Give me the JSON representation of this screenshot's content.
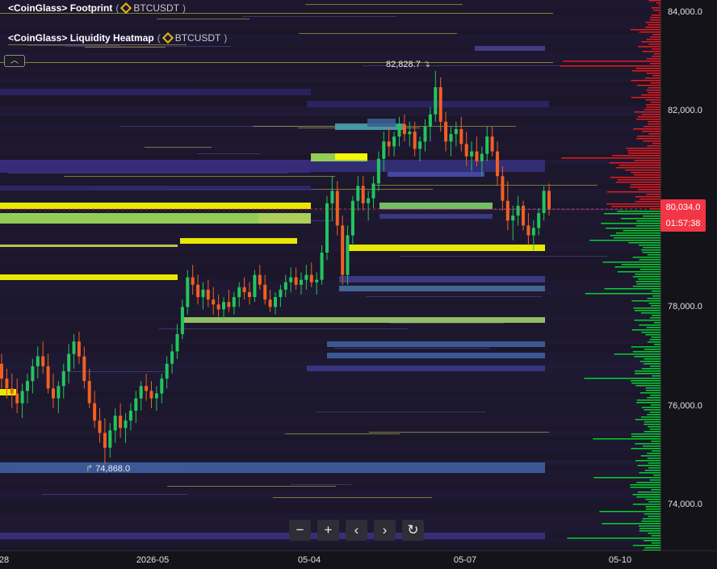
{
  "legend": {
    "footprint": {
      "name": "<CoinGlass> Footprint",
      "symbol": "BTCUSDT"
    },
    "heatmap": {
      "name": "<CoinGlass> Liquidity Heatmap",
      "symbol": "BTCUSDT"
    }
  },
  "collapse_icon": "chevron-up-icon",
  "annotations": {
    "high": "82,828.7",
    "low": "74,868.0"
  },
  "price_axis": {
    "ticks": [
      "84,000.0",
      "82,000.0",
      "78,000.0",
      "76,000.0",
      "74,000.0"
    ]
  },
  "current_price": {
    "price": "80,034.0",
    "countdown": "01:57:38",
    "color": "#f23645"
  },
  "time_axis": {
    "ticks": [
      "28",
      "2026-05",
      "05-04",
      "05-07",
      "05-10"
    ]
  },
  "toolbar": {
    "zoom_out": "−",
    "zoom_in": "+",
    "scroll_left": "‹",
    "scroll_right": "›",
    "reset": "↻"
  },
  "colors": {
    "bull": "#22c55e",
    "bear": "#f25f22",
    "bid_profile": "#00e62e",
    "ask_profile": "#ff1a1a",
    "heat_hot": "#ffff00",
    "heat_warm": "#9ee05a",
    "heat_mid": "#3f5fa0",
    "heat_cold": "#3b2d7a"
  },
  "chart_data": {
    "type": "candlestick",
    "series": [
      {
        "values": [
          [
            76.9,
            77.1,
            76.4,
            76.6
          ],
          [
            76.6,
            76.8,
            76.2,
            76.4
          ],
          [
            76.4,
            76.7,
            76.0,
            76.3
          ],
          [
            76.3,
            76.6,
            75.9,
            76.1
          ],
          [
            76.1,
            76.5,
            75.8,
            76.35
          ],
          [
            76.35,
            76.7,
            76.1,
            76.55
          ],
          [
            76.55,
            77.0,
            76.3,
            76.85
          ],
          [
            76.85,
            77.25,
            76.6,
            77.05
          ],
          [
            77.05,
            77.35,
            76.7,
            76.85
          ],
          [
            76.85,
            77.1,
            76.3,
            76.4
          ],
          [
            76.4,
            76.7,
            76.0,
            76.2
          ],
          [
            76.2,
            76.55,
            75.9,
            76.45
          ],
          [
            76.45,
            76.9,
            76.2,
            76.75
          ],
          [
            76.75,
            77.3,
            76.5,
            77.1
          ],
          [
            77.1,
            77.5,
            76.8,
            77.35
          ],
          [
            77.35,
            77.55,
            76.9,
            77.05
          ],
          [
            77.05,
            77.25,
            76.4,
            76.55
          ],
          [
            76.55,
            76.8,
            76.0,
            76.1
          ],
          [
            76.1,
            76.35,
            75.6,
            75.75
          ],
          [
            75.75,
            76.0,
            75.3,
            75.5
          ],
          [
            75.5,
            75.8,
            74.87,
            75.2
          ],
          [
            75.2,
            75.7,
            75.0,
            75.55
          ],
          [
            75.55,
            76.0,
            75.3,
            75.85
          ],
          [
            75.85,
            76.1,
            75.4,
            75.6
          ],
          [
            75.6,
            75.9,
            75.3,
            75.75
          ],
          [
            75.75,
            76.1,
            75.55,
            75.95
          ],
          [
            75.95,
            76.35,
            75.7,
            76.2
          ],
          [
            76.2,
            76.55,
            75.95,
            76.45
          ],
          [
            76.45,
            76.7,
            76.15,
            76.35
          ],
          [
            76.35,
            76.55,
            76.0,
            76.2
          ],
          [
            76.2,
            76.45,
            75.95,
            76.3
          ],
          [
            76.3,
            76.7,
            76.1,
            76.6
          ],
          [
            76.6,
            77.05,
            76.4,
            76.9
          ],
          [
            76.9,
            77.3,
            76.7,
            77.15
          ],
          [
            77.15,
            77.7,
            77.0,
            77.5
          ],
          [
            77.5,
            78.2,
            77.4,
            78.05
          ],
          [
            78.05,
            78.8,
            77.9,
            78.65
          ],
          [
            78.65,
            78.9,
            78.3,
            78.5
          ],
          [
            78.5,
            78.7,
            78.1,
            78.25
          ],
          [
            78.25,
            78.55,
            78.0,
            78.4
          ],
          [
            78.4,
            78.6,
            78.05,
            78.2
          ],
          [
            78.2,
            78.45,
            77.9,
            78.1
          ],
          [
            78.1,
            78.3,
            77.85,
            78.0
          ],
          [
            78.0,
            78.25,
            77.8,
            78.15
          ],
          [
            78.15,
            78.4,
            77.95,
            78.05
          ],
          [
            78.05,
            78.35,
            77.9,
            78.25
          ],
          [
            78.25,
            78.55,
            78.05,
            78.45
          ],
          [
            78.45,
            78.65,
            78.2,
            78.35
          ],
          [
            78.35,
            78.55,
            78.1,
            78.25
          ],
          [
            78.25,
            78.8,
            78.15,
            78.7
          ],
          [
            78.7,
            78.9,
            78.4,
            78.5
          ],
          [
            78.5,
            78.7,
            78.1,
            78.2
          ],
          [
            78.2,
            78.4,
            77.95,
            78.05
          ],
          [
            78.05,
            78.35,
            77.9,
            78.25
          ],
          [
            78.25,
            78.5,
            78.05,
            78.4
          ],
          [
            78.4,
            78.7,
            78.25,
            78.55
          ],
          [
            78.55,
            78.85,
            78.35,
            78.65
          ],
          [
            78.65,
            78.85,
            78.4,
            78.5
          ],
          [
            78.5,
            78.75,
            78.3,
            78.6
          ],
          [
            78.6,
            78.9,
            78.4,
            78.7
          ],
          [
            78.7,
            78.95,
            78.45,
            78.55
          ],
          [
            78.55,
            78.75,
            78.3,
            78.6
          ],
          [
            78.6,
            79.3,
            78.5,
            79.15
          ],
          [
            79.15,
            80.3,
            79.0,
            80.15
          ],
          [
            80.15,
            80.7,
            79.8,
            80.4
          ],
          [
            80.4,
            80.6,
            79.5,
            79.7
          ],
          [
            79.7,
            79.9,
            78.5,
            78.7
          ],
          [
            78.7,
            79.7,
            78.5,
            79.5
          ],
          [
            79.5,
            80.3,
            79.3,
            80.2
          ],
          [
            80.2,
            80.7,
            80.0,
            80.5
          ],
          [
            80.5,
            80.7,
            80.0,
            80.15
          ],
          [
            80.15,
            80.4,
            79.8,
            80.25
          ],
          [
            80.25,
            80.7,
            80.05,
            80.55
          ],
          [
            80.55,
            81.2,
            80.4,
            81.05
          ],
          [
            81.05,
            81.6,
            80.8,
            81.4
          ],
          [
            81.4,
            81.7,
            81.1,
            81.3
          ],
          [
            81.3,
            81.6,
            81.1,
            81.5
          ],
          [
            81.5,
            81.9,
            81.3,
            81.75
          ],
          [
            81.75,
            81.95,
            81.4,
            81.55
          ],
          [
            81.55,
            81.8,
            81.3,
            81.6
          ],
          [
            81.6,
            81.8,
            81.1,
            81.25
          ],
          [
            81.25,
            81.5,
            81.0,
            81.4
          ],
          [
            81.4,
            81.85,
            81.2,
            81.7
          ],
          [
            81.7,
            82.1,
            81.4,
            81.95
          ],
          [
            81.95,
            82.83,
            81.8,
            82.5
          ],
          [
            82.5,
            82.7,
            81.6,
            81.8
          ],
          [
            81.8,
            82.0,
            81.2,
            81.4
          ],
          [
            81.4,
            81.7,
            81.1,
            81.55
          ],
          [
            81.55,
            81.8,
            81.3,
            81.65
          ],
          [
            81.65,
            81.9,
            81.2,
            81.35
          ],
          [
            81.35,
            81.6,
            80.9,
            81.1
          ],
          [
            81.1,
            81.4,
            80.8,
            81.2
          ],
          [
            81.2,
            81.5,
            80.9,
            81.0
          ],
          [
            81.0,
            81.3,
            80.7,
            81.15
          ],
          [
            81.15,
            81.7,
            81.0,
            81.5
          ],
          [
            81.5,
            81.7,
            81.1,
            81.2
          ],
          [
            81.2,
            81.4,
            80.5,
            80.7
          ],
          [
            80.7,
            80.9,
            80.0,
            80.2
          ],
          [
            80.2,
            80.6,
            79.6,
            79.8
          ],
          [
            79.8,
            80.1,
            79.4,
            79.9
          ],
          [
            79.9,
            80.3,
            79.7,
            80.1
          ],
          [
            80.1,
            80.2,
            79.6,
            79.7
          ],
          [
            79.7,
            79.95,
            79.3,
            79.5
          ],
          [
            79.5,
            79.8,
            79.2,
            79.65
          ],
          [
            79.65,
            80.05,
            79.5,
            79.95
          ],
          [
            79.95,
            80.5,
            79.8,
            80.4
          ],
          [
            80.4,
            80.55,
            79.9,
            80.03
          ]
        ]
      }
    ]
  }
}
